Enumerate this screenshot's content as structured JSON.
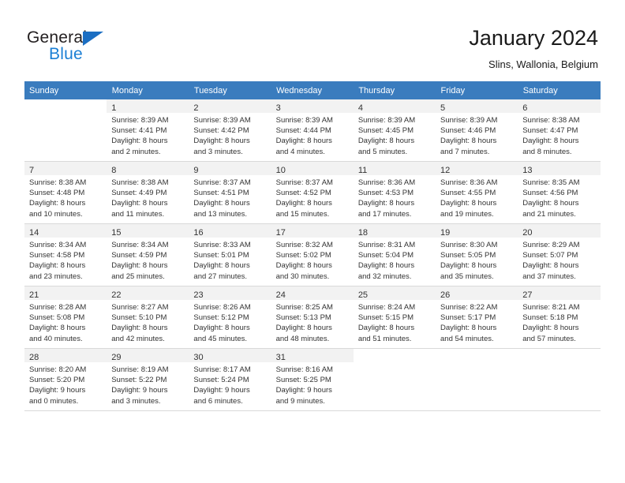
{
  "brand": {
    "name_part1": "General",
    "name_part2": "Blue",
    "triangle_color": "#1b6ec2",
    "blue_color": "#1b7fd4"
  },
  "header": {
    "title": "January 2024",
    "subtitle": "Slins, Wallonia, Belgium"
  },
  "theme": {
    "header_row_bg": "#3a7cbe",
    "header_row_text": "#ffffff",
    "daynum_bg": "#f2f2f2",
    "grid_line": "#d9d9d9",
    "body_text": "#333333"
  },
  "weekdays": [
    "Sunday",
    "Monday",
    "Tuesday",
    "Wednesday",
    "Thursday",
    "Friday",
    "Saturday"
  ],
  "weeks": [
    [
      {
        "day": "",
        "lines": []
      },
      {
        "day": "1",
        "lines": [
          "Sunrise: 8:39 AM",
          "Sunset: 4:41 PM",
          "Daylight: 8 hours",
          "and 2 minutes."
        ]
      },
      {
        "day": "2",
        "lines": [
          "Sunrise: 8:39 AM",
          "Sunset: 4:42 PM",
          "Daylight: 8 hours",
          "and 3 minutes."
        ]
      },
      {
        "day": "3",
        "lines": [
          "Sunrise: 8:39 AM",
          "Sunset: 4:44 PM",
          "Daylight: 8 hours",
          "and 4 minutes."
        ]
      },
      {
        "day": "4",
        "lines": [
          "Sunrise: 8:39 AM",
          "Sunset: 4:45 PM",
          "Daylight: 8 hours",
          "and 5 minutes."
        ]
      },
      {
        "day": "5",
        "lines": [
          "Sunrise: 8:39 AM",
          "Sunset: 4:46 PM",
          "Daylight: 8 hours",
          "and 7 minutes."
        ]
      },
      {
        "day": "6",
        "lines": [
          "Sunrise: 8:38 AM",
          "Sunset: 4:47 PM",
          "Daylight: 8 hours",
          "and 8 minutes."
        ]
      }
    ],
    [
      {
        "day": "7",
        "lines": [
          "Sunrise: 8:38 AM",
          "Sunset: 4:48 PM",
          "Daylight: 8 hours",
          "and 10 minutes."
        ]
      },
      {
        "day": "8",
        "lines": [
          "Sunrise: 8:38 AM",
          "Sunset: 4:49 PM",
          "Daylight: 8 hours",
          "and 11 minutes."
        ]
      },
      {
        "day": "9",
        "lines": [
          "Sunrise: 8:37 AM",
          "Sunset: 4:51 PM",
          "Daylight: 8 hours",
          "and 13 minutes."
        ]
      },
      {
        "day": "10",
        "lines": [
          "Sunrise: 8:37 AM",
          "Sunset: 4:52 PM",
          "Daylight: 8 hours",
          "and 15 minutes."
        ]
      },
      {
        "day": "11",
        "lines": [
          "Sunrise: 8:36 AM",
          "Sunset: 4:53 PM",
          "Daylight: 8 hours",
          "and 17 minutes."
        ]
      },
      {
        "day": "12",
        "lines": [
          "Sunrise: 8:36 AM",
          "Sunset: 4:55 PM",
          "Daylight: 8 hours",
          "and 19 minutes."
        ]
      },
      {
        "day": "13",
        "lines": [
          "Sunrise: 8:35 AM",
          "Sunset: 4:56 PM",
          "Daylight: 8 hours",
          "and 21 minutes."
        ]
      }
    ],
    [
      {
        "day": "14",
        "lines": [
          "Sunrise: 8:34 AM",
          "Sunset: 4:58 PM",
          "Daylight: 8 hours",
          "and 23 minutes."
        ]
      },
      {
        "day": "15",
        "lines": [
          "Sunrise: 8:34 AM",
          "Sunset: 4:59 PM",
          "Daylight: 8 hours",
          "and 25 minutes."
        ]
      },
      {
        "day": "16",
        "lines": [
          "Sunrise: 8:33 AM",
          "Sunset: 5:01 PM",
          "Daylight: 8 hours",
          "and 27 minutes."
        ]
      },
      {
        "day": "17",
        "lines": [
          "Sunrise: 8:32 AM",
          "Sunset: 5:02 PM",
          "Daylight: 8 hours",
          "and 30 minutes."
        ]
      },
      {
        "day": "18",
        "lines": [
          "Sunrise: 8:31 AM",
          "Sunset: 5:04 PM",
          "Daylight: 8 hours",
          "and 32 minutes."
        ]
      },
      {
        "day": "19",
        "lines": [
          "Sunrise: 8:30 AM",
          "Sunset: 5:05 PM",
          "Daylight: 8 hours",
          "and 35 minutes."
        ]
      },
      {
        "day": "20",
        "lines": [
          "Sunrise: 8:29 AM",
          "Sunset: 5:07 PM",
          "Daylight: 8 hours",
          "and 37 minutes."
        ]
      }
    ],
    [
      {
        "day": "21",
        "lines": [
          "Sunrise: 8:28 AM",
          "Sunset: 5:08 PM",
          "Daylight: 8 hours",
          "and 40 minutes."
        ]
      },
      {
        "day": "22",
        "lines": [
          "Sunrise: 8:27 AM",
          "Sunset: 5:10 PM",
          "Daylight: 8 hours",
          "and 42 minutes."
        ]
      },
      {
        "day": "23",
        "lines": [
          "Sunrise: 8:26 AM",
          "Sunset: 5:12 PM",
          "Daylight: 8 hours",
          "and 45 minutes."
        ]
      },
      {
        "day": "24",
        "lines": [
          "Sunrise: 8:25 AM",
          "Sunset: 5:13 PM",
          "Daylight: 8 hours",
          "and 48 minutes."
        ]
      },
      {
        "day": "25",
        "lines": [
          "Sunrise: 8:24 AM",
          "Sunset: 5:15 PM",
          "Daylight: 8 hours",
          "and 51 minutes."
        ]
      },
      {
        "day": "26",
        "lines": [
          "Sunrise: 8:22 AM",
          "Sunset: 5:17 PM",
          "Daylight: 8 hours",
          "and 54 minutes."
        ]
      },
      {
        "day": "27",
        "lines": [
          "Sunrise: 8:21 AM",
          "Sunset: 5:18 PM",
          "Daylight: 8 hours",
          "and 57 minutes."
        ]
      }
    ],
    [
      {
        "day": "28",
        "lines": [
          "Sunrise: 8:20 AM",
          "Sunset: 5:20 PM",
          "Daylight: 9 hours",
          "and 0 minutes."
        ]
      },
      {
        "day": "29",
        "lines": [
          "Sunrise: 8:19 AM",
          "Sunset: 5:22 PM",
          "Daylight: 9 hours",
          "and 3 minutes."
        ]
      },
      {
        "day": "30",
        "lines": [
          "Sunrise: 8:17 AM",
          "Sunset: 5:24 PM",
          "Daylight: 9 hours",
          "and 6 minutes."
        ]
      },
      {
        "day": "31",
        "lines": [
          "Sunrise: 8:16 AM",
          "Sunset: 5:25 PM",
          "Daylight: 9 hours",
          "and 9 minutes."
        ]
      },
      {
        "day": "",
        "lines": []
      },
      {
        "day": "",
        "lines": []
      },
      {
        "day": "",
        "lines": []
      }
    ]
  ]
}
